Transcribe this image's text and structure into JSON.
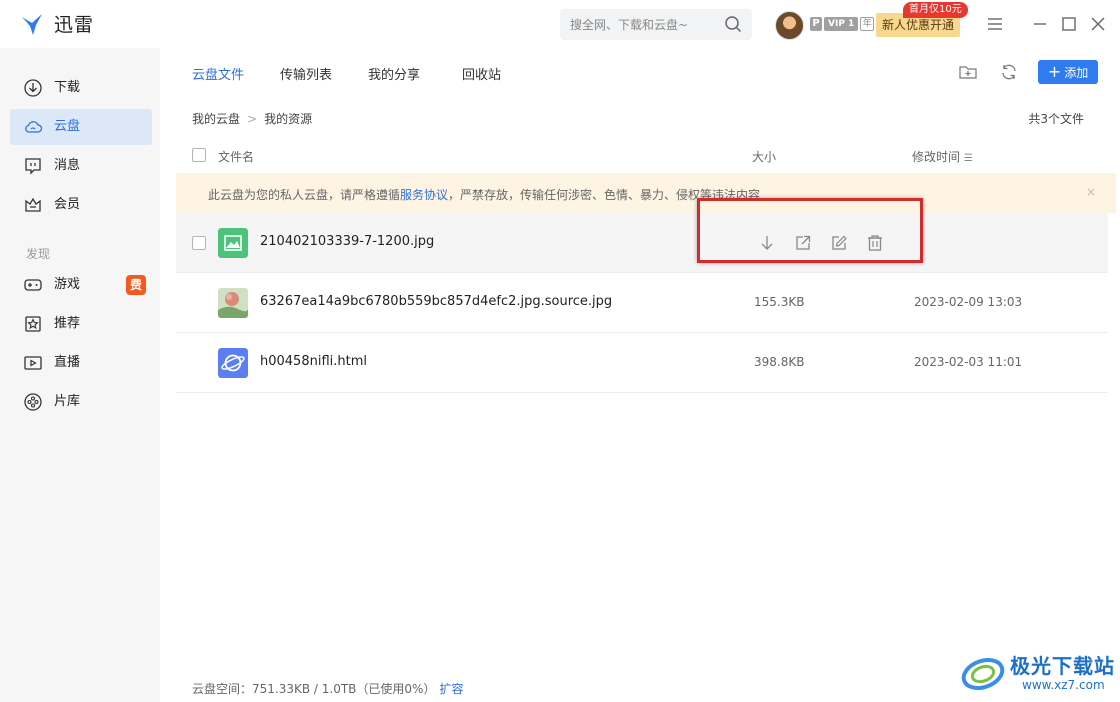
{
  "app": {
    "name": "迅雷"
  },
  "search": {
    "placeholder": "搜全网、下载和云盘~"
  },
  "account": {
    "vip_p": "P",
    "vip_level": "VIP 1",
    "vip_year": "年",
    "promo_label": "新人优惠开通",
    "promo_tag": "首月仅10元"
  },
  "sidebar": {
    "items": [
      {
        "label": "下载",
        "icon": "download-circle-icon"
      },
      {
        "label": "云盘",
        "icon": "cloud-icon",
        "active": true
      },
      {
        "label": "消息",
        "icon": "message-icon"
      },
      {
        "label": "会员",
        "icon": "crown-icon"
      }
    ],
    "section_label": "发现",
    "discover": [
      {
        "label": "游戏",
        "icon": "gamepad-icon",
        "badge": "费"
      },
      {
        "label": "推荐",
        "icon": "star-icon"
      },
      {
        "label": "直播",
        "icon": "live-icon"
      },
      {
        "label": "片库",
        "icon": "film-reel-icon"
      }
    ]
  },
  "tabs": [
    {
      "label": "云盘文件",
      "active": true
    },
    {
      "label": "传输列表"
    },
    {
      "label": "我的分享"
    },
    {
      "label": "回收站"
    }
  ],
  "toolbar": {
    "add_label": "添加"
  },
  "breadcrumb": {
    "root": "我的云盘",
    "current": "我的资源"
  },
  "file_count": "共3个文件",
  "columns": {
    "name": "文件名",
    "size": "大小",
    "modified": "修改时间"
  },
  "notice": {
    "prefix": "此云盘为您的私人云盘，请严格遵循",
    "link": "服务协议",
    "suffix": "，严禁存放，传输任何涉密、色情、暴力、侵权等违法内容",
    "close": "×"
  },
  "files": [
    {
      "name": "210402103339-7-1200.jpg",
      "size": "",
      "modified": "",
      "icon": "image-file-icon"
    },
    {
      "name": "63267ea14a9bc6780b559bc857d4efc2.jpg.source.jpg",
      "size": "155.3KB",
      "modified": "2023-02-09 13:03",
      "icon": "photo-thumbnail"
    },
    {
      "name": "h00458nifli.html",
      "size": "398.8KB",
      "modified": "2023-02-03 11:01",
      "icon": "html-file-icon"
    }
  ],
  "footer": {
    "space": "云盘空间：751.33KB / 1.0TB（已使用0%）",
    "expand": "扩容"
  },
  "watermark": {
    "title": "极光下载站",
    "url": "www.xz7.com"
  },
  "colors": {
    "accent": "#2e6fd8",
    "highlight": "#d12b2b",
    "notice_bg": "#fdf4e4",
    "promo": "#f8d78e"
  }
}
